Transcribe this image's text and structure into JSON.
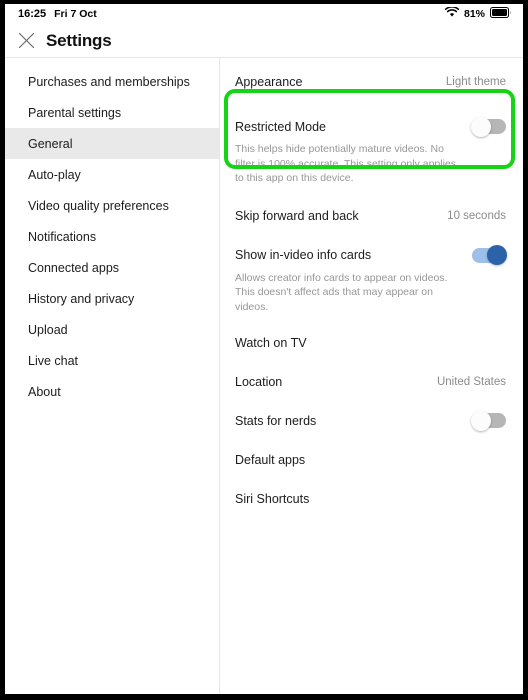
{
  "status_bar": {
    "time": "16:25",
    "date": "Fri 7 Oct",
    "wifi_icon": "wifi-icon",
    "battery_percent": "81%",
    "battery_icon": "battery-icon"
  },
  "header": {
    "close_icon": "close-icon",
    "title": "Settings"
  },
  "sidebar": {
    "items": [
      {
        "label": "Purchases and memberships",
        "active": false
      },
      {
        "label": "Parental settings",
        "active": false
      },
      {
        "label": "General",
        "active": true
      },
      {
        "label": "Auto-play",
        "active": false
      },
      {
        "label": "Video quality preferences",
        "active": false
      },
      {
        "label": "Notifications",
        "active": false
      },
      {
        "label": "Connected apps",
        "active": false
      },
      {
        "label": "History and privacy",
        "active": false
      },
      {
        "label": "Upload",
        "active": false
      },
      {
        "label": "Live chat",
        "active": false
      },
      {
        "label": "About",
        "active": false
      }
    ]
  },
  "content": {
    "appearance": {
      "label": "Appearance",
      "value": "Light theme"
    },
    "restricted_mode": {
      "label": "Restricted Mode",
      "toggle_state": "off",
      "description": "This helps hide potentially mature videos. No filter is 100% accurate. This setting only applies to this app on this device."
    },
    "skip_forward_back": {
      "label": "Skip forward and back",
      "value": "10 seconds"
    },
    "info_cards": {
      "label": "Show in-video info cards",
      "toggle_state": "on",
      "description": "Allows creator info cards to appear on videos. This doesn't affect ads that may appear on videos."
    },
    "watch_on_tv": {
      "label": "Watch on TV"
    },
    "location": {
      "label": "Location",
      "value": "United States"
    },
    "stats_for_nerds": {
      "label": "Stats for nerds",
      "toggle_state": "off"
    },
    "default_apps": {
      "label": "Default apps"
    },
    "siri_shortcuts": {
      "label": "Siri Shortcuts"
    }
  },
  "annotation": {
    "highlight_color": "#15d415",
    "highlight_target": "restricted-mode-row"
  }
}
